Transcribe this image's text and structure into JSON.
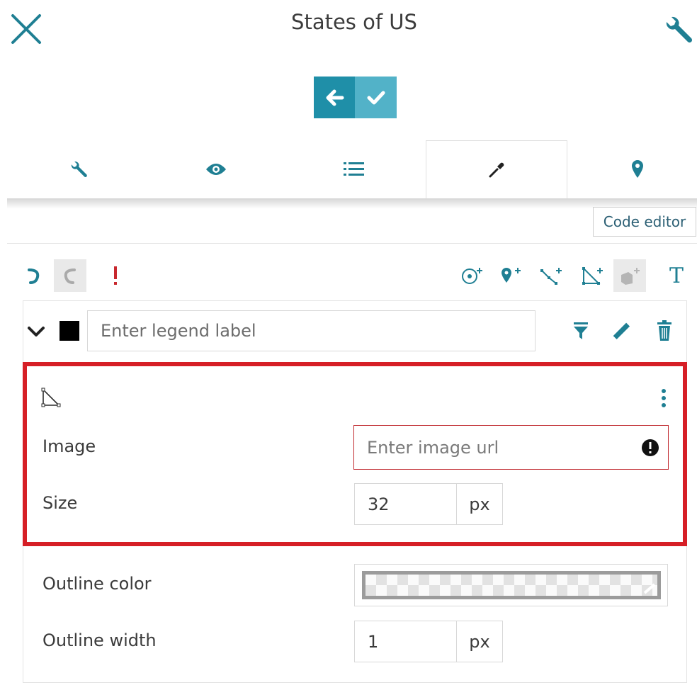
{
  "header": {
    "title": "States of US"
  },
  "tabs": [
    "settings-tab",
    "visibility-tab",
    "list-tab",
    "style-tab",
    "marker-tab"
  ],
  "code_editor_label": "Code editor",
  "legend": {
    "placeholder": "Enter legend label",
    "swatch_color": "#000000"
  },
  "style_panel": {
    "image_label": "Image",
    "image_placeholder": "Enter image url",
    "size_label": "Size",
    "size_value": "32",
    "size_unit": "px",
    "outline_color_label": "Outline color",
    "outline_width_label": "Outline width",
    "outline_width_value": "1",
    "outline_width_unit": "px"
  },
  "toolbar": {
    "text_tool_label": "T"
  },
  "colors": {
    "accent_dark": "#1f8fa8",
    "accent_light": "#52b2c8",
    "highlight": "#d61f26",
    "icon_teal": "#1f7f93"
  }
}
